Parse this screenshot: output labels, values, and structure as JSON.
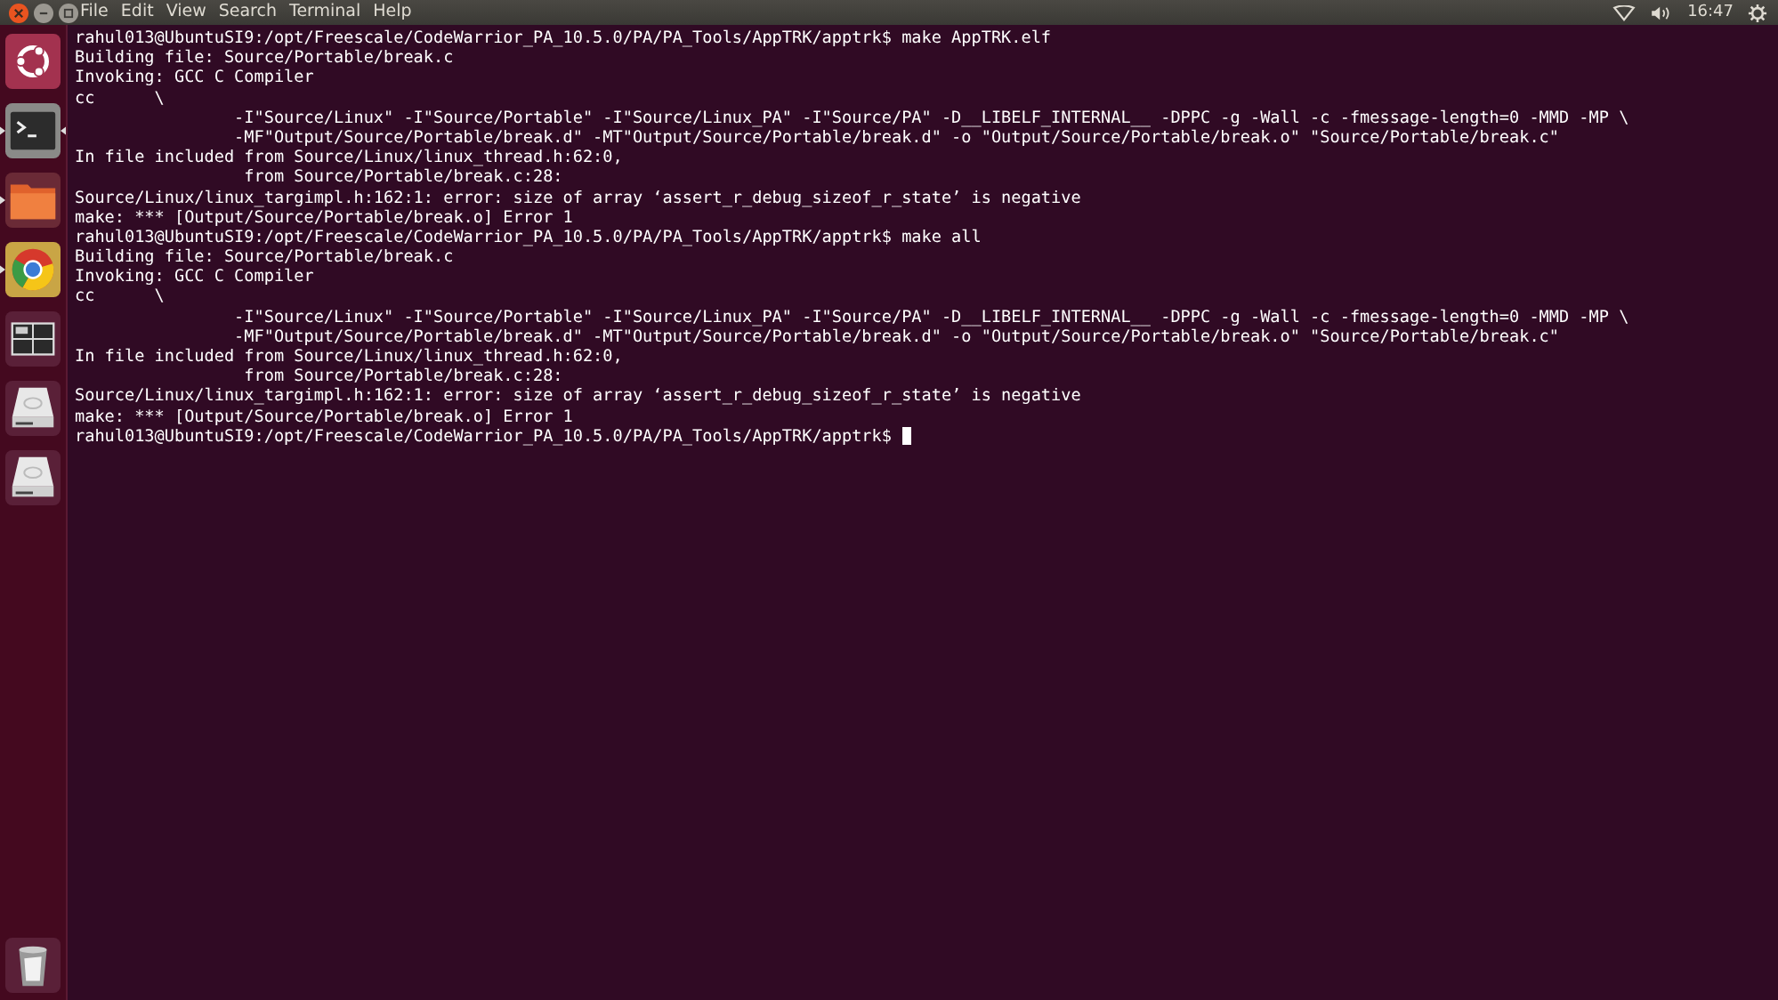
{
  "top_bar": {
    "menu": [
      "File",
      "Edit",
      "View",
      "Search",
      "Terminal",
      "Help"
    ],
    "clock": "16:47"
  },
  "launcher": {
    "items": [
      {
        "kind": "dash",
        "running": false,
        "focused": false
      },
      {
        "kind": "terminal",
        "running": true,
        "focused": true
      },
      {
        "kind": "files",
        "running": true,
        "focused": false
      },
      {
        "kind": "browser",
        "running": true,
        "focused": false
      },
      {
        "kind": "workspaces",
        "running": false,
        "focused": false
      },
      {
        "kind": "drive",
        "running": false,
        "focused": false
      },
      {
        "kind": "drive",
        "running": false,
        "focused": false
      }
    ],
    "trash": {
      "kind": "trash"
    }
  },
  "terminal": {
    "lines": [
      "rahul013@UbuntuSI9:/opt/Freescale/CodeWarrior_PA_10.5.0/PA/PA_Tools/AppTRK/apptrk$ make AppTRK.elf",
      "Building file: Source/Portable/break.c",
      "Invoking: GCC C Compiler",
      "cc      \\",
      "                -I\"Source/Linux\" -I\"Source/Portable\" -I\"Source/Linux_PA\" -I\"Source/PA\" -D__LIBELF_INTERNAL__ -DPPC -g -Wall -c -fmessage-length=0 -MMD -MP \\",
      "                -MF\"Output/Source/Portable/break.d\" -MT\"Output/Source/Portable/break.d\" -o \"Output/Source/Portable/break.o\" \"Source/Portable/break.c\"",
      "In file included from Source/Linux/linux_thread.h:62:0,",
      "                 from Source/Portable/break.c:28:",
      "Source/Linux/linux_targimpl.h:162:1: error: size of array ‘assert_r_debug_sizeof_r_state’ is negative",
      "make: *** [Output/Source/Portable/break.o] Error 1",
      "rahul013@UbuntuSI9:/opt/Freescale/CodeWarrior_PA_10.5.0/PA/PA_Tools/AppTRK/apptrk$ make all",
      "Building file: Source/Portable/break.c",
      "Invoking: GCC C Compiler",
      "cc      \\",
      "                -I\"Source/Linux\" -I\"Source/Portable\" -I\"Source/Linux_PA\" -I\"Source/PA\" -D__LIBELF_INTERNAL__ -DPPC -g -Wall -c -fmessage-length=0 -MMD -MP \\",
      "                -MF\"Output/Source/Portable/break.d\" -MT\"Output/Source/Portable/break.d\" -o \"Output/Source/Portable/break.o\" \"Source/Portable/break.c\"",
      "In file included from Source/Linux/linux_thread.h:62:0,",
      "                 from Source/Portable/break.c:28:",
      "Source/Linux/linux_targimpl.h:162:1: error: size of array ‘assert_r_debug_sizeof_r_state’ is negative",
      "make: *** [Output/Source/Portable/break.o] Error 1",
      "rahul013@UbuntuSI9:/opt/Freescale/CodeWarrior_PA_10.5.0/PA/PA_Tools/AppTRK/apptrk$ "
    ],
    "cursor": true
  }
}
